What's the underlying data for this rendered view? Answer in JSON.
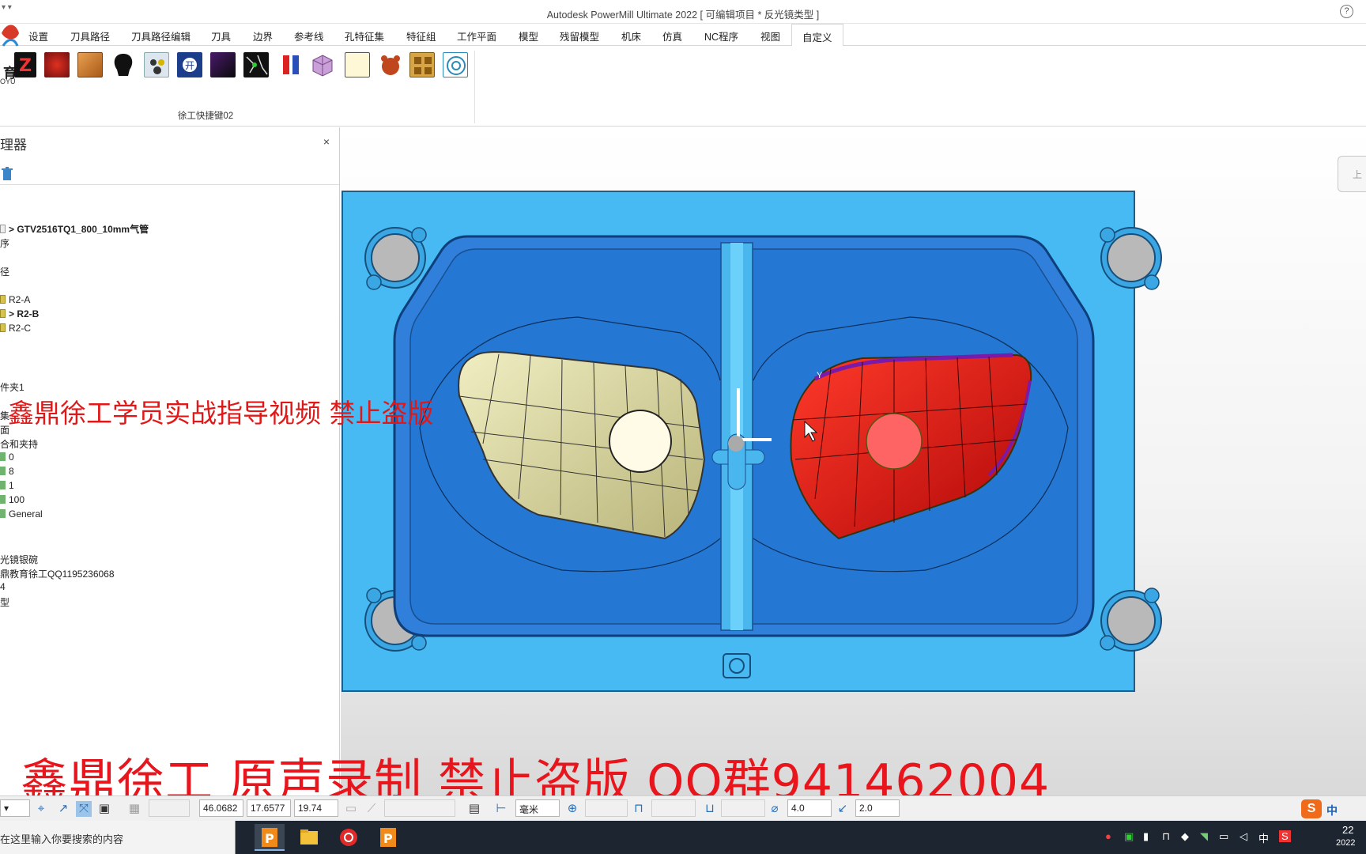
{
  "titlebar": {
    "title": "Autodesk PowerMill Ultimate 2022    [ 可编辑项目 * 反光镜类型 ]",
    "help": "?"
  },
  "tabs": [
    "设置",
    "刀具路径",
    "刀具路径编辑",
    "刀具",
    "边界",
    "参考线",
    "孔特征集",
    "特征组",
    "工作平面",
    "模型",
    "残留模型",
    "机床",
    "仿真",
    "NC程序",
    "视图",
    "自定义"
  ],
  "ribbon": {
    "group_label": "徐工快捷键02",
    "logo_text_1": "育",
    "logo_text_2": "OYU",
    "icons": [
      "z-macro-icon",
      "red-texture-icon",
      "box-icon",
      "blob-icon",
      "toolset-icon",
      "wizard-icon",
      "black-square-icon",
      "scatter-icon",
      "split-icon",
      "cube-icon",
      "page-icon",
      "bear-icon",
      "grid-icon",
      "target-icon"
    ]
  },
  "panel": {
    "title": "理器",
    "close": "×",
    "items": [
      {
        "label": "> GTV2516TQ1_800_10mm气管",
        "icon": "folder",
        "bold": true
      },
      {
        "label": "序",
        "icon": "",
        "bold": false
      },
      {
        "label": "径",
        "icon": "",
        "bold": false
      },
      {
        "label": "R2-A",
        "icon": "folder",
        "bold": false
      },
      {
        "label": "> R2-B",
        "icon": "folder",
        "bold": true
      },
      {
        "label": "R2-C",
        "icon": "folder",
        "bold": false
      },
      {
        "label": "件夹1",
        "icon": "",
        "bold": false
      },
      {
        "label": "集",
        "icon": "",
        "bold": false
      },
      {
        "label": "面",
        "icon": "",
        "bold": false
      },
      {
        "label": "合和夹持",
        "icon": "",
        "bold": false
      },
      {
        "label": "0",
        "icon": "green",
        "bold": false
      },
      {
        "label": "8",
        "icon": "green",
        "bold": false
      },
      {
        "label": "1",
        "icon": "green",
        "bold": false
      },
      {
        "label": "100",
        "icon": "green",
        "bold": false
      },
      {
        "label": "General",
        "icon": "green",
        "bold": false
      },
      {
        "label": "光镜银碗",
        "icon": "",
        "bold": false
      },
      {
        "label": "鼎教育徐工QQ1195236068",
        "icon": "",
        "bold": false
      },
      {
        "label": "4",
        "icon": "",
        "bold": false
      },
      {
        "label": "型",
        "icon": "",
        "bold": false
      }
    ]
  },
  "viewport": {
    "axis_label": "Y",
    "viewcube_label": "上"
  },
  "watermarks": {
    "line1": "鑫鼎徐工学员实战指导视频    禁止盗版",
    "line2": "鑫鼎徐工 原声录制 禁止盗版  QQ群941462004"
  },
  "statusbar": {
    "x": "46.0682",
    "y": "17.6577",
    "z": "19.74",
    "unit": "毫米",
    "diameter": "4.0",
    "stepover": "2.0"
  },
  "taskbar": {
    "search_placeholder": "在这里输入你要搜索的内容",
    "ime": "中",
    "clock": "22",
    "date": "2022"
  },
  "colors": {
    "mold_base": "#43b7f1",
    "cavity": "#2a78d6",
    "part_left": "#ddd9a2",
    "part_right": "#e01414",
    "watermark": "#e8161c"
  }
}
